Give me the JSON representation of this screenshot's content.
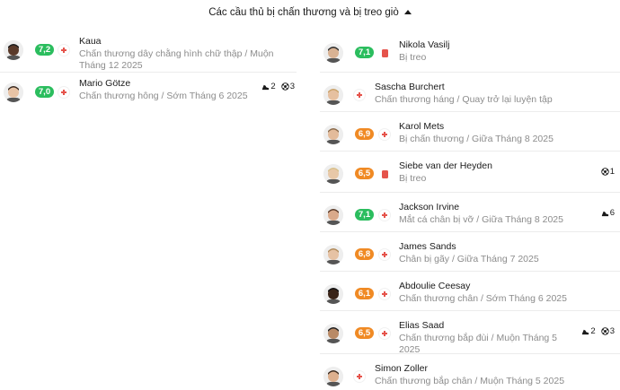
{
  "header": {
    "title": "Các cầu thủ bị chấn thương và bị treo giò"
  },
  "colors": {
    "green": "#2bbd5e",
    "orange": "#f08a24",
    "red": "#e5534b"
  },
  "left": [
    {
      "name": "Kaua",
      "status": "Chấn thương dây chằng hình chữ thập / Muộn Tháng 12 2025",
      "rating": "7,2",
      "rating_color": "green",
      "mark": "injury",
      "skin": "#5a3a2a",
      "hair": "#1b1b1b"
    },
    {
      "name": "Mario Götze",
      "status": "Chấn thương hông / Sớm Tháng 6 2025",
      "rating": "7,0",
      "rating_color": "green",
      "mark": "injury",
      "skin": "#e8c3a5",
      "hair": "#3a2a20",
      "assists": "2",
      "goals": "3"
    }
  ],
  "right": [
    {
      "name": "Nikola Vasilj",
      "status": "Bị treo",
      "rating": "7,1",
      "rating_color": "green",
      "mark": "red-card",
      "skin": "#d9b293",
      "hair": "#2a2a2a"
    },
    {
      "name": "Sascha Burchert",
      "status": "Chấn thương háng / Quay trở lại luyện tập",
      "rating": "",
      "mark": "injury",
      "skin": "#e6c0a0",
      "hair": "#c9a26a"
    },
    {
      "name": "Karol Mets",
      "status": "Bị chấn thương / Giữa Tháng 8 2025",
      "rating": "6,9",
      "rating_color": "orange",
      "mark": "injury",
      "skin": "#e3bb9b",
      "hair": "#8a6a4a"
    },
    {
      "name": "Siebe van der Heyden",
      "status": "Bị treo",
      "rating": "6,5",
      "rating_color": "orange",
      "mark": "red-card",
      "skin": "#e8c8a8",
      "hair": "#d8c08a",
      "goals": "1"
    },
    {
      "name": "Jackson Irvine",
      "status": "Mắt cá chân bị vỡ / Giữa Tháng 8 2025",
      "rating": "7,1",
      "rating_color": "green",
      "mark": "injury",
      "skin": "#d9a98a",
      "hair": "#5a3a28",
      "assists": "6"
    },
    {
      "name": "James Sands",
      "status": "Chân bị gãy / Giữa Tháng 7 2025",
      "rating": "6,8",
      "rating_color": "orange",
      "mark": "injury",
      "skin": "#e6c2a4",
      "hair": "#b08a5a"
    },
    {
      "name": "Abdoulie Ceesay",
      "status": "Chấn thương chân / Sớm Tháng 6 2025",
      "rating": "6,1",
      "rating_color": "orange",
      "mark": "injury",
      "skin": "#3a2418",
      "hair": "#111111"
    },
    {
      "name": "Elias Saad",
      "status": "Chấn thương bắp đùi / Muộn Tháng 5 2025",
      "rating": "6,5",
      "rating_color": "orange",
      "mark": "injury",
      "skin": "#b98a66",
      "hair": "#1d1d1d",
      "assists": "2",
      "goals": "3"
    },
    {
      "name": "Simon Zoller",
      "status": "Chấn thương bắp chân / Muộn Tháng 5 2025",
      "rating": "",
      "mark": "injury",
      "skin": "#ddb08e",
      "hair": "#3a2a1e"
    }
  ]
}
